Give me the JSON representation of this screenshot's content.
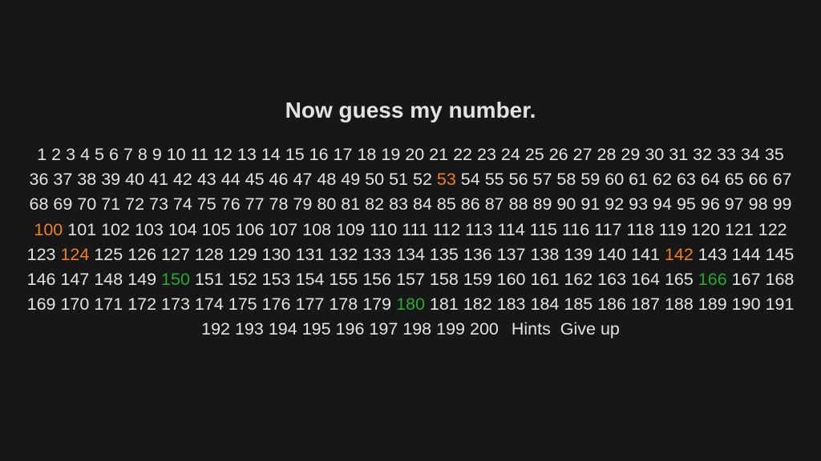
{
  "prompt": "Now guess my number.",
  "range": {
    "min": 1,
    "max": 200
  },
  "guess_colors": {
    "default": "#e2e2e2",
    "warm": "#f07f1e",
    "close": "#2aa92a"
  },
  "warm_guesses": [
    53,
    100,
    124,
    142
  ],
  "close_guesses": [
    150,
    166,
    180
  ],
  "actions": {
    "hints": "Hints",
    "give_up": "Give up"
  }
}
